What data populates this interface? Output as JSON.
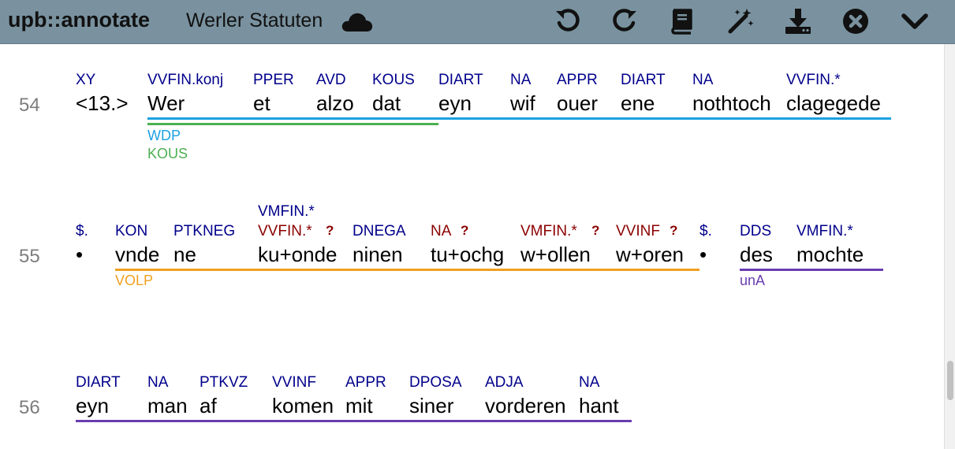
{
  "toolbar": {
    "app_title": "upb::annotate",
    "doc_title": "Werler Statuten"
  },
  "colors": {
    "toolbar_bg": "#7a929f",
    "tag": "#00008b",
    "tag_error": "#8b0000",
    "anno_blue": "#1ba1e2",
    "anno_green": "#4caf50",
    "anno_orange": "#f0a020",
    "anno_purple": "#6a3db0"
  },
  "lines": [
    {
      "number": "54",
      "tokens": [
        {
          "word": "<13.>",
          "tags": [
            "XY"
          ]
        },
        {
          "word": "Wer",
          "tags": [
            "VVFIN.konj"
          ]
        },
        {
          "word": "et",
          "tags": [
            "PPER"
          ]
        },
        {
          "word": "alzo",
          "tags": [
            "AVD"
          ]
        },
        {
          "word": "dat",
          "tags": [
            "KOUS"
          ]
        },
        {
          "word": "eyn",
          "tags": [
            "DIART"
          ]
        },
        {
          "word": "wif",
          "tags": [
            "NA"
          ]
        },
        {
          "word": "ouer",
          "tags": [
            "APPR"
          ]
        },
        {
          "word": "ene",
          "tags": [
            "DIART"
          ]
        },
        {
          "word": "nothtoch",
          "tags": [
            "NA"
          ]
        },
        {
          "word": "clagegede",
          "tags": [
            "VVFIN.*"
          ]
        }
      ],
      "annotations": [
        {
          "label": "WDP",
          "color": "#1ba1e2"
        },
        {
          "label": "KOUS",
          "color": "#4caf50"
        }
      ]
    },
    {
      "number": "55",
      "tokens": [
        {
          "word": "•",
          "tags": [
            "$."
          ]
        },
        {
          "word": "vnde",
          "tags": [
            "KON"
          ]
        },
        {
          "word": "ne",
          "tags": [
            "PTKNEG"
          ]
        },
        {
          "word": "ku+onde",
          "tags": [
            "VMFIN.*",
            "VVFIN.*"
          ],
          "flag": "?"
        },
        {
          "word": "ninen",
          "tags": [
            "DNEGA"
          ]
        },
        {
          "word": "tu+ochg",
          "tags": [
            "NA"
          ],
          "flag": "?"
        },
        {
          "word": "w+ollen",
          "tags": [
            "VMFIN.*"
          ],
          "flag": "?"
        },
        {
          "word": "w+oren",
          "tags": [
            "VVINF"
          ],
          "flag": "?"
        },
        {
          "word": "•",
          "tags": [
            "$."
          ]
        },
        {
          "word": "des",
          "tags": [
            "DDS"
          ]
        },
        {
          "word": "mochte",
          "tags": [
            "VMFIN.*"
          ]
        }
      ],
      "annotations": [
        {
          "label": "VOLP",
          "color": "#f0a020"
        },
        {
          "label": "unA",
          "color": "#6a3db0"
        }
      ]
    },
    {
      "number": "56",
      "tokens": [
        {
          "word": "eyn",
          "tags": [
            "DIART"
          ]
        },
        {
          "word": "man",
          "tags": [
            "NA"
          ]
        },
        {
          "word": "af",
          "tags": [
            "PTKVZ"
          ]
        },
        {
          "word": "komen",
          "tags": [
            "VVINF"
          ]
        },
        {
          "word": "mit",
          "tags": [
            "APPR"
          ]
        },
        {
          "word": "siner",
          "tags": [
            "DPOSA"
          ]
        },
        {
          "word": "vorderen",
          "tags": [
            "ADJA"
          ]
        },
        {
          "word": "hant",
          "tags": [
            "NA"
          ]
        }
      ],
      "annotations": []
    }
  ]
}
